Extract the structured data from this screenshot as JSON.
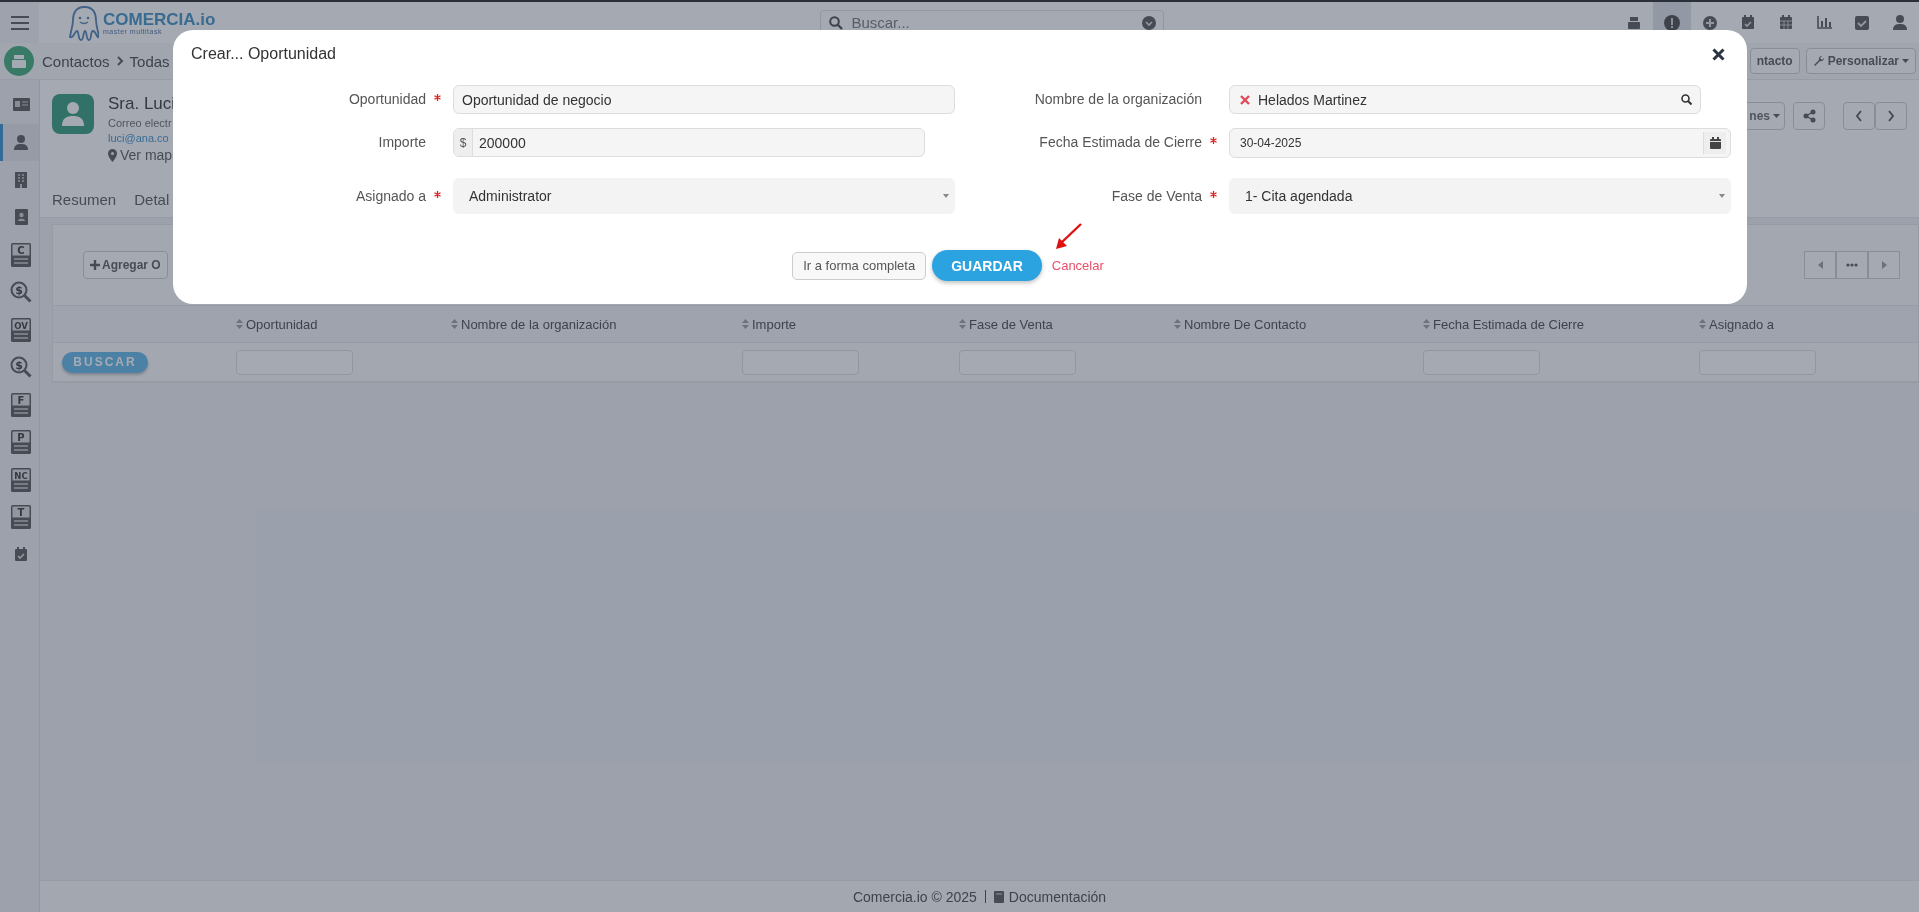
{
  "topbar": {
    "logo": {
      "name": "COMERCIA.io",
      "tagline": "master multitask"
    },
    "search": {
      "placeholder": "Buscar..."
    },
    "icons": [
      {
        "kind": "register",
        "selected": false
      },
      {
        "kind": "alert",
        "selected": true
      },
      {
        "kind": "plus",
        "selected": false
      },
      {
        "kind": "calendar-check",
        "selected": false
      },
      {
        "kind": "calendar",
        "selected": false
      },
      {
        "kind": "chart",
        "selected": false
      },
      {
        "kind": "checkbox",
        "selected": false
      },
      {
        "kind": "user",
        "selected": false
      }
    ]
  },
  "breadcrumb": [
    "Contactos",
    "Todas"
  ],
  "header_buttons": [
    {
      "kind": "plain",
      "label": "ntacto"
    },
    {
      "kind": "wrench-menu",
      "label": "Personalizar"
    }
  ],
  "sidebar": {
    "items": [
      {
        "kind": "id-card",
        "selected": false
      },
      {
        "kind": "person",
        "selected": true
      },
      {
        "kind": "building",
        "selected": false
      },
      {
        "kind": "contact-book",
        "selected": false
      },
      {
        "kind": "doc",
        "letter": "C",
        "selected": false
      },
      {
        "kind": "search-money",
        "symbol": "$",
        "selected": false
      },
      {
        "kind": "doc",
        "letter": "OV",
        "selected": false
      },
      {
        "kind": "search-money",
        "symbol": "$",
        "selected": false
      },
      {
        "kind": "doc",
        "letter": "F",
        "selected": false
      },
      {
        "kind": "doc",
        "letter": "P",
        "selected": false
      },
      {
        "kind": "doc",
        "letter": "NC",
        "selected": false
      },
      {
        "kind": "doc",
        "letter": "T",
        "selected": false
      },
      {
        "kind": "calendar-check",
        "selected": false
      }
    ]
  },
  "contact": {
    "name": "Sra. Luci",
    "email_label": "Correo electr",
    "email": "luci@ana.co",
    "map_link": "Ver map",
    "actions_label": "nes"
  },
  "tabs": [
    "Resumen",
    "Detal"
  ],
  "panel": {
    "add_button": "Agregar O",
    "search_button": "BUSCAR",
    "columns": [
      {
        "label": "Oportunidad",
        "filter": true
      },
      {
        "label": "Nombre de la organización",
        "filter": false
      },
      {
        "label": "Importe",
        "filter": true
      },
      {
        "label": "Fase de Venta",
        "filter": true
      },
      {
        "label": "Nombre De Contacto",
        "filter": false
      },
      {
        "label": "Fecha Estimada de Cierre",
        "filter": true
      },
      {
        "label": "Asignado a",
        "filter": true
      }
    ]
  },
  "modal": {
    "title": "Crear... Oportunidad",
    "fields": [
      {
        "label": "Oportunidad",
        "required": true,
        "kind": "text",
        "value": "Oportunidad de negocio"
      },
      {
        "label": "Nombre de la organización",
        "required": false,
        "kind": "lookup",
        "value": "Helados Martinez"
      },
      {
        "label": "Importe",
        "required": false,
        "kind": "currency",
        "prefix": "$",
        "value": "200000"
      },
      {
        "label": "Fecha Estimada de Cierre",
        "required": true,
        "kind": "date",
        "value": "30-04-2025"
      },
      {
        "label": "Asignado a",
        "required": true,
        "kind": "select",
        "value": "Administrator"
      },
      {
        "label": "Fase de Venta",
        "required": true,
        "kind": "select",
        "value": "1- Cita agendada"
      }
    ],
    "buttons": {
      "full_form": "Ir a forma completa",
      "save": "GUARDAR",
      "cancel": "Cancelar"
    }
  },
  "footer": {
    "copyright": "Comercia.io © 2025",
    "link": "Documentación"
  }
}
